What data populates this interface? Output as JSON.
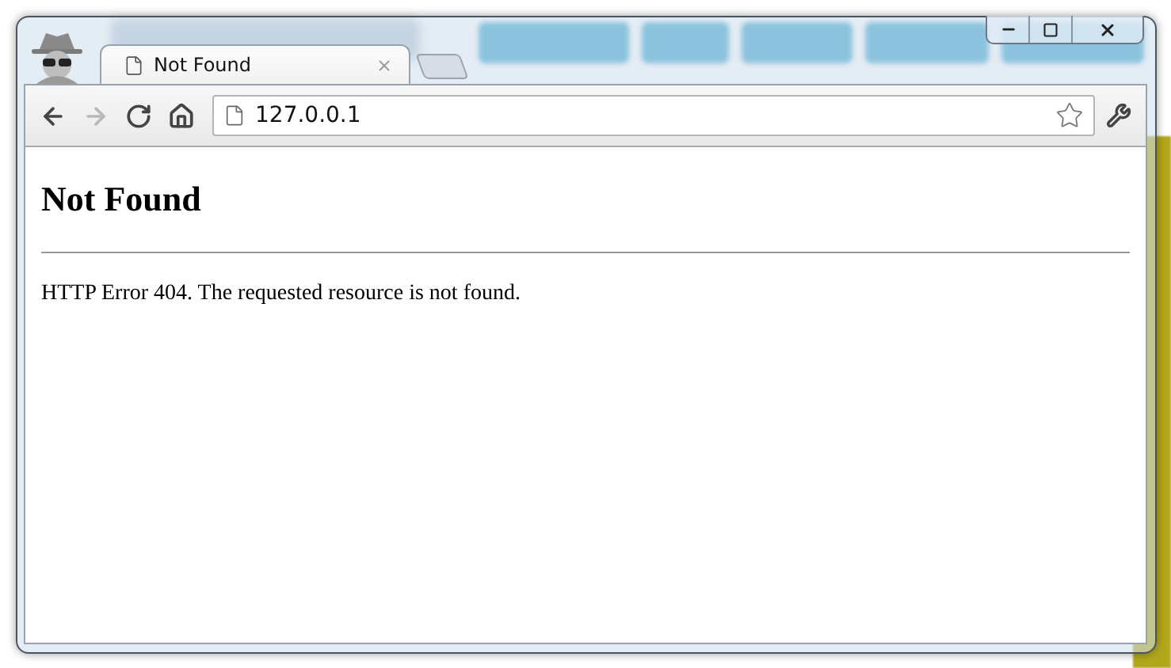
{
  "window": {
    "incognito": true,
    "tabs": [
      {
        "title": "Not Found",
        "selected": true
      }
    ],
    "toolbar": [
      {
        "kind": "back",
        "disabled": false
      },
      {
        "kind": "forward",
        "disabled": true
      },
      {
        "kind": "reload",
        "disabled": false
      },
      {
        "kind": "home",
        "disabled": false
      }
    ],
    "address": "127.0.0.1",
    "bookmarked": false
  },
  "page": {
    "heading": "Not Found",
    "message": "HTTP Error 404. The requested resource is not found."
  }
}
